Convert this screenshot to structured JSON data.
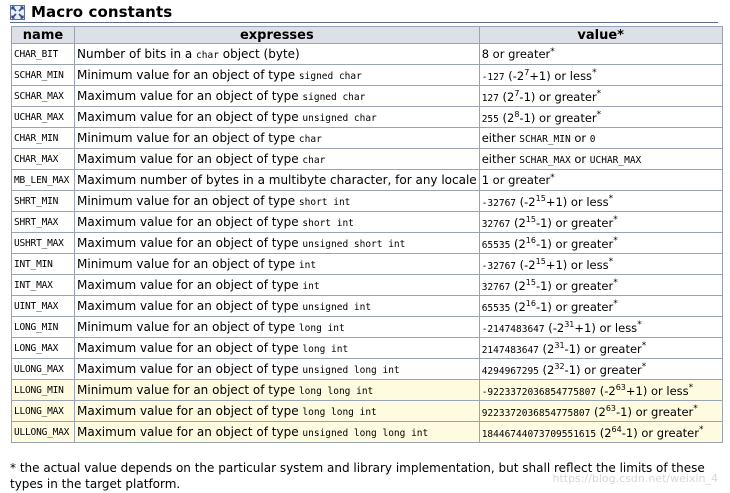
{
  "heading": {
    "title": "Macro constants"
  },
  "table": {
    "headers": [
      "name",
      "expresses",
      "value*"
    ],
    "rows": [
      {
        "name": "CHAR_BIT",
        "expr_text": "Number of bits in a ",
        "expr_code": "char",
        "expr_tail": " object (byte)",
        "value": "8 or greater*"
      },
      {
        "name": "SCHAR_MIN",
        "expr_text": "Minimum value for an object of type ",
        "expr_code": "signed char",
        "value": "-127 (-2^7+1) or less*"
      },
      {
        "name": "SCHAR_MAX",
        "expr_text": "Maximum value for an object of type ",
        "expr_code": "signed char",
        "value": "127 (2^7-1) or greater*"
      },
      {
        "name": "UCHAR_MAX",
        "expr_text": "Maximum value for an object of type ",
        "expr_code": "unsigned char",
        "value": "255 (2^8-1) or greater*"
      },
      {
        "name": "CHAR_MIN",
        "expr_text": "Minimum value for an object of type ",
        "expr_code": "char",
        "value": "either SCHAR_MIN or 0"
      },
      {
        "name": "CHAR_MAX",
        "expr_text": "Maximum value for an object of type ",
        "expr_code": "char",
        "value": "either SCHAR_MAX or UCHAR_MAX"
      },
      {
        "name": "MB_LEN_MAX",
        "expr_text": "Maximum number of bytes in a multibyte character, for any locale",
        "expr_code": "",
        "value": "1 or greater*"
      },
      {
        "name": "SHRT_MIN",
        "expr_text": "Minimum value for an object of type ",
        "expr_code": "short int",
        "value": "-32767 (-2^15+1) or less*"
      },
      {
        "name": "SHRT_MAX",
        "expr_text": "Maximum value for an object of type ",
        "expr_code": "short int",
        "value": "32767 (2^15-1) or greater*"
      },
      {
        "name": "USHRT_MAX",
        "expr_text": "Maximum value for an object of type ",
        "expr_code": "unsigned short int",
        "value": "65535 (2^16-1) or greater*"
      },
      {
        "name": "INT_MIN",
        "expr_text": "Minimum value for an object of type ",
        "expr_code": "int",
        "value": "-32767 (-2^15+1) or less*"
      },
      {
        "name": "INT_MAX",
        "expr_text": "Maximum value for an object of type ",
        "expr_code": "int",
        "value": "32767 (2^15-1) or greater*"
      },
      {
        "name": "UINT_MAX",
        "expr_text": "Maximum value for an object of type ",
        "expr_code": "unsigned int",
        "value": "65535 (2^16-1) or greater*"
      },
      {
        "name": "LONG_MIN",
        "expr_text": "Minimum value for an object of type ",
        "expr_code": "long int",
        "value": "-2147483647 (-2^31+1) or less*"
      },
      {
        "name": "LONG_MAX",
        "expr_text": "Maximum value for an object of type ",
        "expr_code": "long int",
        "value": "2147483647 (2^31-1) or greater*"
      },
      {
        "name": "ULONG_MAX",
        "expr_text": "Maximum value for an object of type ",
        "expr_code": "unsigned long int",
        "value": "4294967295 (2^32-1) or greater*"
      },
      {
        "name": "LLONG_MIN",
        "expr_text": "Minimum value for an object of type ",
        "expr_code": "long long int",
        "value": "-9223372036854775807 (-2^63+1) or less*",
        "highlight": true
      },
      {
        "name": "LLONG_MAX",
        "expr_text": "Maximum value for an object of type ",
        "expr_code": "long long int",
        "value": "9223372036854775807 (2^63-1) or greater*",
        "highlight": true
      },
      {
        "name": "ULLONG_MAX",
        "expr_text": "Maximum value for an object of type ",
        "expr_code": "unsigned long long int",
        "value": "18446744073709551615 (2^64-1) or greater*",
        "highlight": true
      }
    ]
  },
  "footnote": "* the actual value depends on the particular system and library implementation, but shall reflect the limits of these types in the target platform.",
  "watermark": "https://blog.csdn.net/weixin_4",
  "colors": {
    "heading_rule": "#5a6c95",
    "header_bg": "#dde0e6",
    "border": "#9aa3b1",
    "highlight_row": "#fffbe0"
  },
  "icons": {
    "heading": "grid-arrows-icon"
  }
}
